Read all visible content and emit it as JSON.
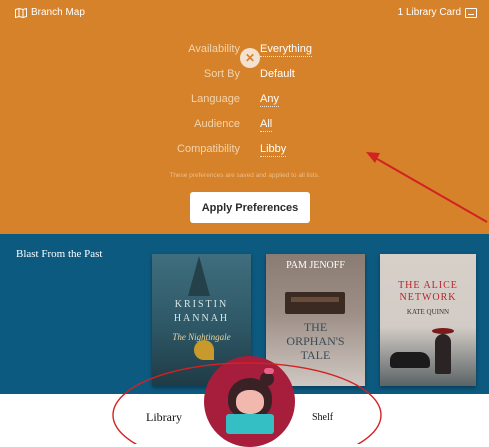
{
  "topbar": {
    "branch_map_label": "Branch Map",
    "library_card_label": "1 Library Card",
    "map_icon": "map-icon",
    "card_icon": "card-icon"
  },
  "preferences": {
    "close_icon": "close-icon",
    "rows": [
      {
        "label": "Availability",
        "value": "Everything"
      },
      {
        "label": "Sort By",
        "value": "Default"
      },
      {
        "label": "Language",
        "value": "Any"
      },
      {
        "label": "Audience",
        "value": "All"
      },
      {
        "label": "Compatibility",
        "value": "Libby"
      }
    ],
    "note": "These preferences are saved and applied to all lists.",
    "apply_label": "Apply Preferences"
  },
  "shelf": {
    "title": "Blast From the Past",
    "books": [
      {
        "author": "KRISTIN HANNAH",
        "title": "The Nightingale"
      },
      {
        "author": "PAM JENOFF",
        "title": "THE ORPHAN'S TALE"
      },
      {
        "author": "KATE QUINN",
        "title": "THE ALICE NETWORK"
      }
    ]
  },
  "nav": {
    "library_label": "Library",
    "shelf_label": "Shelf",
    "libby_icon": "libby-logo-icon"
  },
  "colors": {
    "panel": "#d6822a",
    "shelf_bg": "#0d5a80",
    "annotation": "#d22222",
    "libby_brand": "#a71d3c"
  }
}
